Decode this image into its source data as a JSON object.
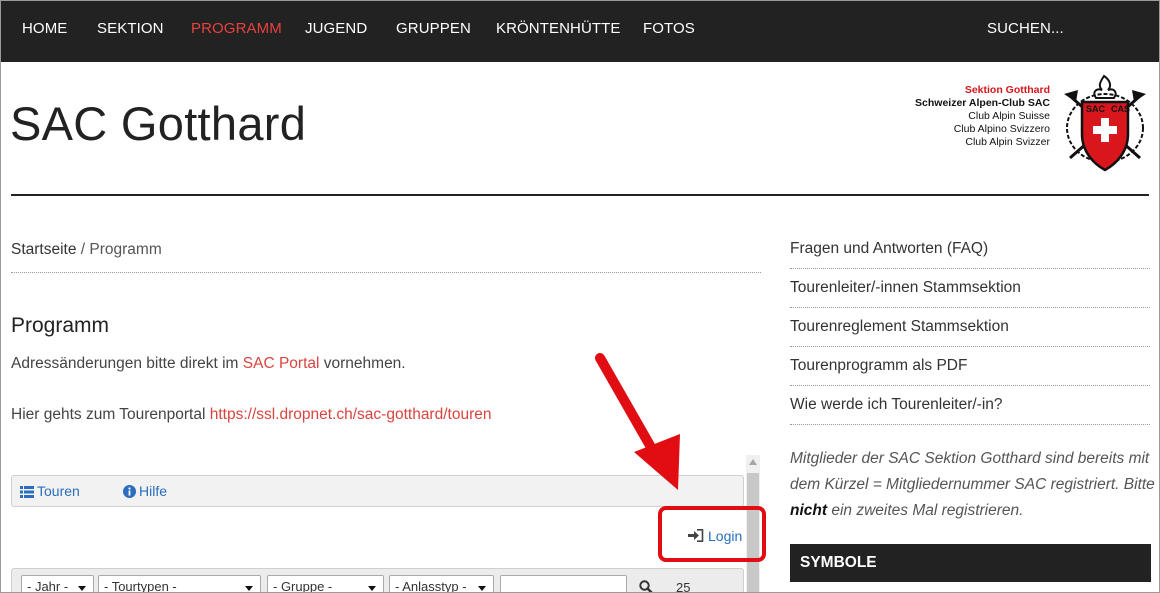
{
  "nav": {
    "items": [
      {
        "label": "HOME",
        "active": false
      },
      {
        "label": "SEKTION",
        "active": false
      },
      {
        "label": "PROGRAMM",
        "active": true
      },
      {
        "label": "JUGEND",
        "active": false
      },
      {
        "label": "GRUPPEN",
        "active": false
      },
      {
        "label": "KRÖNTENHÜTTE",
        "active": false
      },
      {
        "label": "FOTOS",
        "active": false
      }
    ],
    "search_label": "SUCHEN...",
    "accent_color": "#e8423e"
  },
  "header": {
    "site_title": "SAC Gotthard",
    "logo": {
      "line1": "Sektion Gotthard",
      "line2": "Schweizer Alpen-Club SAC",
      "line3": "Club Alpin Suisse",
      "line4": "Club Alpino Svizzero",
      "line5": "Club Alpin Svizzer",
      "emblem_text": "SAC CAS"
    }
  },
  "breadcrumb": {
    "home": "Startseite",
    "separator": " / ",
    "current": "Programm"
  },
  "main": {
    "heading": "Programm",
    "p1_before": "Adressänderungen bitte direkt im ",
    "p1_link": "SAC Portal",
    "p1_after": " vornehmen.",
    "p2_before": "Hier gehts zum Tourenportal ",
    "p2_link": "https://ssl.dropnet.ch/sac-gotthard/touren"
  },
  "embed": {
    "tabs": [
      "Touren",
      "Hilfe"
    ],
    "login_label": "Login",
    "filters": {
      "year": "- Jahr -",
      "tour_types": "- Tourtypen -",
      "group": "- Gruppe -",
      "event_type": "- Anlasstyp -",
      "count": "25"
    }
  },
  "sidebar": {
    "links": [
      "Fragen und Antworten (FAQ)",
      "Tourenleiter/-innen Stammsektion",
      "Tourenreglement Stammsektion",
      "Tourenprogramm als PDF",
      "Wie werde ich Tourenleiter/-in?"
    ],
    "note_before": "Mitglieder der SAC Sektion Gotthard sind bereits mit dem Kürzel = Mitgliedernummer SAC registriert. Bitte ",
    "note_bold": "nicht",
    "note_after": " ein zweites Mal registrieren.",
    "section_title": "SYMBOLE"
  },
  "annotation": {
    "highlight_color": "#e10d12"
  }
}
